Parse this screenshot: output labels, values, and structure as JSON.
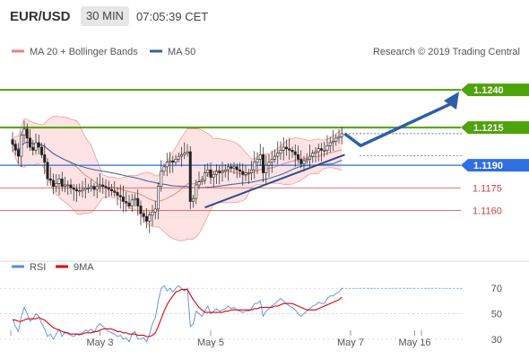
{
  "header": {
    "symbol": "EUR/USD",
    "timeframe": "30 MIN",
    "time": "07:05:39 CET"
  },
  "copyright": "Research © 2019 Trading Central",
  "colors": {
    "bollinger": "#f08080",
    "bollinger_fill": "#fddcdc",
    "ma50": "#3a5f9e",
    "resistance_green": "#4ea20a",
    "support_red": "#e87070",
    "price_blue": "#2f6fe0",
    "trend": "#2d4e8c",
    "arrow": "#2d5fa8",
    "rsi": "#5b8be0",
    "rsi_ma": "#e00000"
  },
  "chart_data": [
    {
      "type": "line",
      "title": "",
      "legend": [
        {
          "name": "MA 20 + Bollinger Bands",
          "color": "#f08080"
        },
        {
          "name": "MA 50",
          "color": "#3a5f9e"
        }
      ],
      "ylim": [
        1.1127,
        1.1277
      ],
      "levels": [
        {
          "value": 1.124,
          "label": "1.1240",
          "style": "resistance"
        },
        {
          "value": 1.1215,
          "label": "1.1215",
          "style": "resistance"
        },
        {
          "value": 1.119,
          "label": "1.1190",
          "style": "current"
        },
        {
          "value": 1.1175,
          "label": "1.1175",
          "style": "support"
        },
        {
          "value": 1.116,
          "label": "1.1160",
          "style": "support"
        }
      ],
      "x_ticks": [
        {
          "bar": 30,
          "label": "May 3"
        },
        {
          "bar": 68,
          "label": "May 5"
        },
        {
          "bar": 116,
          "label": "May 7"
        },
        {
          "bar": 138,
          "label": "May 16"
        }
      ],
      "close": [
        1.1204,
        1.12,
        1.1196,
        1.121,
        1.1214,
        1.1208,
        1.1202,
        1.12,
        1.1205,
        1.1202,
        1.1197,
        1.1192,
        1.1181,
        1.118,
        1.1176,
        1.1178,
        1.1181,
        1.1176,
        1.1177,
        1.1177,
        1.1175,
        1.1174,
        1.1173,
        1.1173,
        1.1174,
        1.1175,
        1.1175,
        1.1176,
        1.1174,
        1.1176,
        1.1177,
        1.1176,
        1.1175,
        1.1174,
        1.1173,
        1.1172,
        1.117,
        1.1169,
        1.1166,
        1.1165,
        1.1163,
        1.1167,
        1.1168,
        1.1163,
        1.1158,
        1.1156,
        1.1153,
        1.1157,
        1.1159,
        1.1161,
        1.1176,
        1.1186,
        1.1189,
        1.1192,
        1.1193,
        1.1192,
        1.1194,
        1.1196,
        1.1197,
        1.1198,
        1.1199,
        1.1166,
        1.1168,
        1.1177,
        1.1179,
        1.118,
        1.1185,
        1.1187,
        1.1182,
        1.1184,
        1.1186,
        1.1185,
        1.1186,
        1.1187,
        1.1189,
        1.1188,
        1.1189,
        1.1187,
        1.1186,
        1.1184,
        1.1185,
        1.1185,
        1.1187,
        1.1192,
        1.1194,
        1.1197,
        1.1185,
        1.119,
        1.1192,
        1.1194,
        1.1196,
        1.1198,
        1.12,
        1.1202,
        1.1201,
        1.12,
        1.1199,
        1.1197,
        1.1194,
        1.1191,
        1.1193,
        1.1194,
        1.1196,
        1.1198,
        1.1199,
        1.1201,
        1.12,
        1.12,
        1.1203,
        1.1205,
        1.1206,
        1.1208,
        1.1209,
        1.1211
      ],
      "bands_labels": [
        "MA 20 + Bollinger Bands",
        "MA 50"
      ],
      "forecast": [
        1.1211,
        1.1203,
        1.124
      ],
      "trendline": [
        [
          66,
          1.1162
        ],
        [
          114,
          1.1197
        ]
      ]
    },
    {
      "type": "line",
      "legend": [
        {
          "name": "RSI",
          "color": "#5b8be0"
        },
        {
          "name": "9MA",
          "color": "#e00000"
        }
      ],
      "ylim": [
        20,
        85
      ],
      "y_ticks": [
        30,
        50,
        70
      ],
      "rsi": [
        46,
        40,
        36,
        48,
        55,
        50,
        44,
        46,
        50,
        48,
        42,
        38,
        32,
        34,
        30,
        34,
        38,
        32,
        36,
        34,
        33,
        32,
        34,
        33,
        35,
        37,
        36,
        38,
        35,
        40,
        42,
        40,
        38,
        36,
        35,
        34,
        32,
        33,
        30,
        31,
        28,
        34,
        36,
        30,
        30,
        31,
        28,
        34,
        42,
        47,
        60,
        70,
        72,
        68,
        70,
        67,
        70,
        72,
        70,
        68,
        70,
        40,
        42,
        52,
        50,
        48,
        52,
        56,
        50,
        52,
        54,
        52,
        53,
        54,
        56,
        54,
        55,
        53,
        52,
        51,
        52,
        52,
        54,
        58,
        58,
        60,
        48,
        52,
        54,
        56,
        58,
        60,
        62,
        60,
        58,
        56,
        55,
        53,
        50,
        48,
        50,
        52,
        54,
        56,
        57,
        59,
        58,
        58,
        62,
        64,
        64,
        66,
        67,
        70
      ],
      "rsi_ma": [
        45,
        45,
        44,
        44,
        45,
        46,
        46,
        46,
        46,
        47,
        46,
        45,
        43,
        41,
        39,
        38,
        37,
        36,
        35,
        35,
        34,
        34,
        34,
        34,
        34,
        35,
        35,
        35,
        36,
        36,
        37,
        38,
        38,
        38,
        38,
        37,
        36,
        36,
        35,
        35,
        34,
        34,
        34,
        33,
        33,
        33,
        32,
        32,
        33,
        35,
        40,
        46,
        52,
        57,
        61,
        64,
        67,
        68,
        69,
        69,
        69,
        65,
        61,
        58,
        55,
        53,
        51,
        51,
        51,
        51,
        51,
        51,
        51,
        52,
        52,
        53,
        53,
        53,
        53,
        53,
        53,
        53,
        53,
        54,
        54,
        55,
        55,
        55,
        55,
        55,
        56,
        56,
        57,
        58,
        58,
        58,
        58,
        57,
        56,
        55,
        54,
        53,
        53,
        53,
        53,
        54,
        55,
        56,
        57,
        58,
        59,
        60,
        61,
        63
      ]
    }
  ]
}
